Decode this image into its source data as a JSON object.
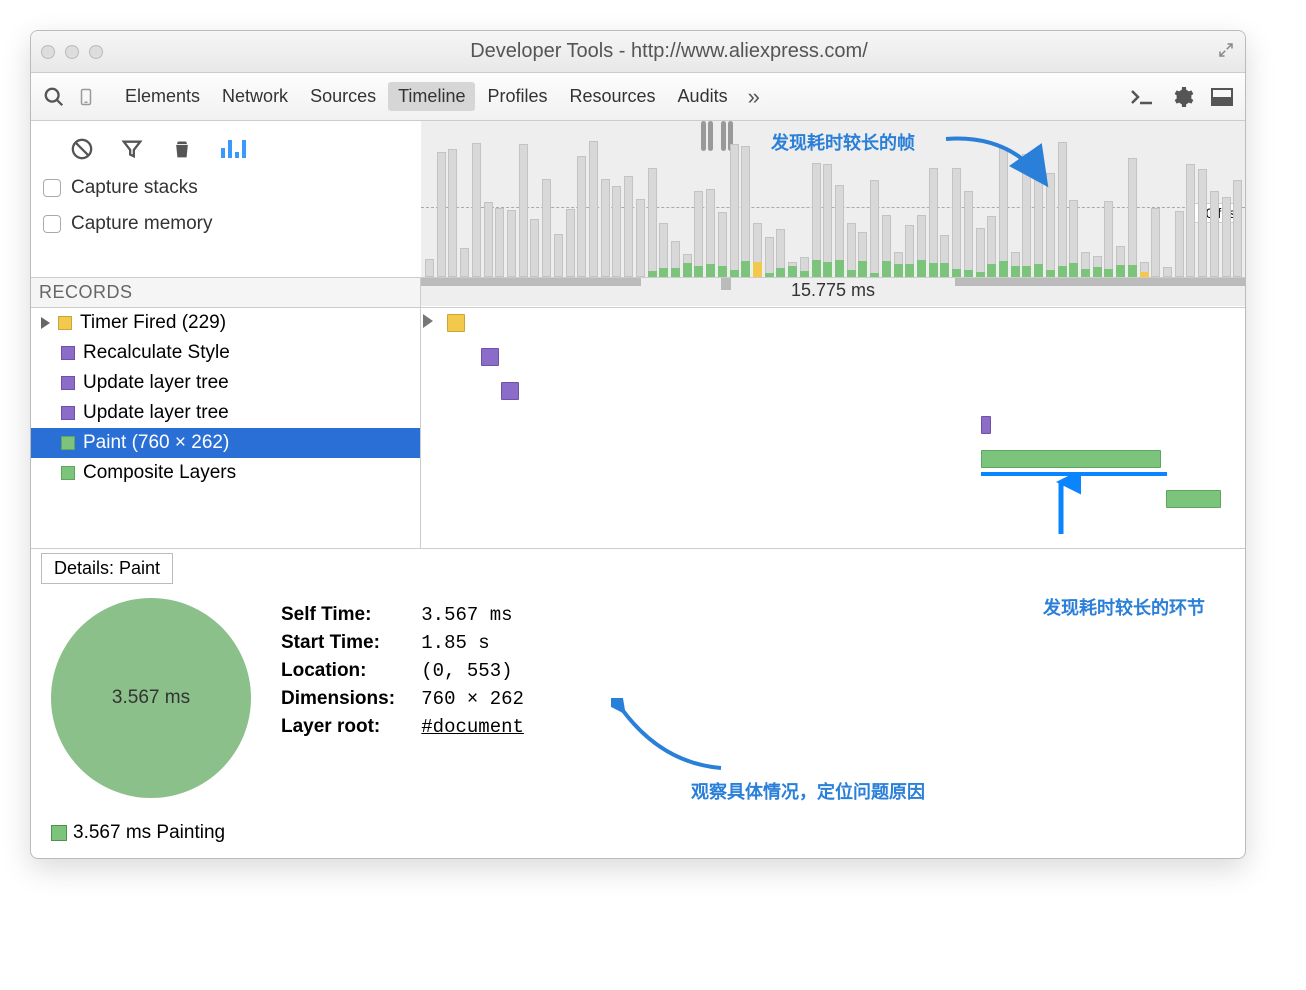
{
  "window": {
    "title": "Developer Tools - http://www.aliexpress.com/"
  },
  "toolbar": {
    "tabs": [
      "Elements",
      "Network",
      "Sources",
      "Timeline",
      "Profiles",
      "Resources",
      "Audits"
    ],
    "active_tab": "Timeline"
  },
  "options": {
    "capture_stacks_label": "Capture stacks",
    "capture_memory_label": "Capture memory"
  },
  "overview": {
    "fps_label": "30 fps"
  },
  "records": {
    "header": "RECORDS",
    "ms_label": "15.775 ms",
    "items": [
      {
        "label": "Timer Fired (229)",
        "color": "yellow",
        "expandable": true
      },
      {
        "label": "Recalculate Style",
        "color": "purple"
      },
      {
        "label": "Update layer tree",
        "color": "purple"
      },
      {
        "label": "Update layer tree",
        "color": "purple"
      },
      {
        "label": "Paint (760 × 262)",
        "color": "green",
        "selected": true
      },
      {
        "label": "Composite Layers",
        "color": "green"
      }
    ]
  },
  "details": {
    "tab_label": "Details: Paint",
    "pie_center": "3.567 ms",
    "legend": "3.567 ms Painting",
    "props": {
      "self_time_label": "Self Time:",
      "self_time_value": "3.567 ms",
      "start_time_label": "Start Time:",
      "start_time_value": "1.85 s",
      "location_label": "Location:",
      "location_value": "(0, 553)",
      "dimensions_label": "Dimensions:",
      "dimensions_value": "760 × 262",
      "layer_root_label": "Layer root:",
      "layer_root_value": "#document"
    }
  },
  "annotations": {
    "a1": "发现耗时较长的帧",
    "a2": "发现耗时较长的环节",
    "a3": "观察具体情况，定位问题原因"
  }
}
